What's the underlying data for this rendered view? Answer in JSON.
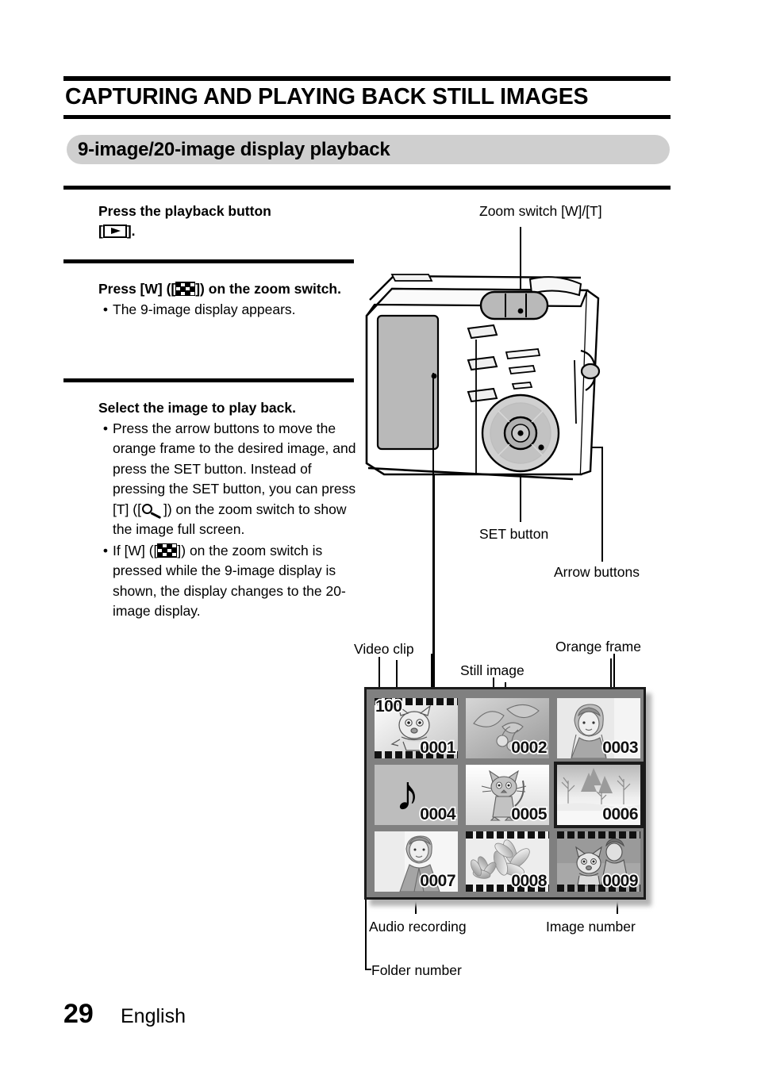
{
  "header": {
    "chapter_title": "CAPTURING AND PLAYING BACK STILL IMAGES",
    "section_title": "9-image/20-image display playback"
  },
  "steps": [
    {
      "heading_before_icon": "Press the playback button",
      "heading_icon": "playback-icon",
      "heading_bracket_open": "[",
      "heading_bracket_close": "].",
      "bullets": []
    },
    {
      "heading_before_icon": "Press [W] ([",
      "heading_icon": "thumbnail-grid-icon",
      "heading_after_icon": "]) on the zoom switch.",
      "bullets": [
        "The 9-image display appears."
      ]
    },
    {
      "heading": "Select the image to play back.",
      "bullets": [
        {
          "part1": "Press the arrow buttons to move the orange frame to the desired image, and press the SET button. Instead of pressing the SET button, you can press [T] ([",
          "icon": "magnifier-icon",
          "part2": "]) on the zoom switch to show the image full screen."
        },
        {
          "part1": "If [W] ([",
          "icon": "thumbnail-grid-icon",
          "part2": "]) on the zoom switch is pressed while the 9-image display is shown, the display changes to the 20-image display."
        }
      ]
    }
  ],
  "callouts": {
    "zoom_switch": "Zoom switch [W]/[T]",
    "set_button": "SET button",
    "arrow_buttons": "Arrow buttons",
    "video_clip": "Video clip",
    "still_image": "Still image",
    "orange_frame": "Orange frame",
    "audio_recording": "Audio recording",
    "image_number": "Image number",
    "folder_number": "Folder number"
  },
  "lcd": {
    "folder_number": "100",
    "selected_index": 5,
    "cells": [
      {
        "number": "0001",
        "kind": "video",
        "subject": "dog"
      },
      {
        "number": "0002",
        "kind": "still",
        "subject": "leaves-berries"
      },
      {
        "number": "0003",
        "kind": "still",
        "subject": "woman-portrait"
      },
      {
        "number": "0004",
        "kind": "audio",
        "subject": "music-note"
      },
      {
        "number": "0005",
        "kind": "still",
        "subject": "cat"
      },
      {
        "number": "0006",
        "kind": "still",
        "subject": "winter-trees"
      },
      {
        "number": "0007",
        "kind": "still",
        "subject": "person"
      },
      {
        "number": "0008",
        "kind": "video",
        "subject": "flowers"
      },
      {
        "number": "0009",
        "kind": "video",
        "subject": "dog-and-person"
      }
    ],
    "audio_glyph": "♪"
  },
  "footer": {
    "page_number": "29",
    "language": "English"
  },
  "colors": {
    "banner_gray": "#cfcfcf",
    "lcd_background": "#808080",
    "selection_frame": "#1a1a1a",
    "rule_black": "#000000"
  }
}
